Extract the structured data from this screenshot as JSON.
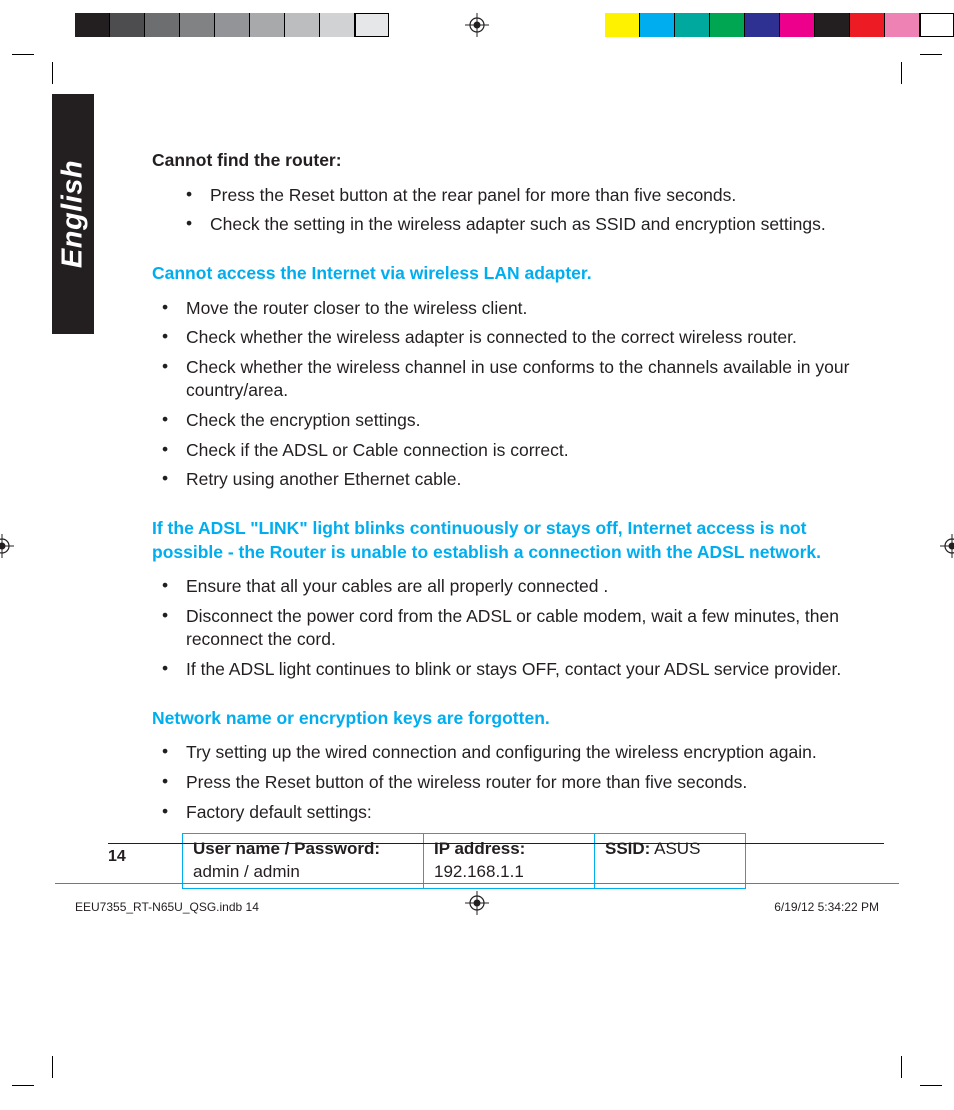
{
  "language_tab": "English",
  "section1": {
    "heading": "Cannot find the router:",
    "items": [
      "Press the Reset button at the rear panel for more than five seconds.",
      "Check the setting in the wireless adapter such as SSID and encryption settings."
    ]
  },
  "section2": {
    "heading": "Cannot access the Internet via wireless LAN adapter.",
    "items": [
      "Move the router closer to the wireless client.",
      "Check whether the wireless adapter is connected to the correct wireless router.",
      "Check whether the wireless channel in use conforms to the channels available in your country/area.",
      "Check the encryption settings.",
      "Check if the ADSL or Cable connection is correct.",
      "Retry using another Ethernet cable."
    ]
  },
  "section3": {
    "heading": "If the ADSL \"LINK\" light blinks continuously or stays off, Internet access is not possible - the Router is unable to establish a connection with the ADSL network.",
    "items": [
      "Ensure that all your cables are all properly connected .",
      "Disconnect the power cord from the ADSL or cable modem, wait a few minutes, then reconnect the cord.",
      "If the ADSL light continues to blink or stays OFF, contact your ADSL service provider."
    ]
  },
  "section4": {
    "heading": "Network name or encryption keys are forgotten.",
    "items": [
      "Try setting up the wired connection and configuring the wireless encryption again.",
      "Press the Reset button of the wireless router for more than five seconds.",
      "Factory default settings:"
    ]
  },
  "defaults_table": {
    "userpass_label": "User name / Password:",
    "userpass_value": "admin / admin",
    "ip_label": "IP address:",
    "ip_value": "192.168.1.1",
    "ssid_label": "SSID:",
    "ssid_value": " ASUS"
  },
  "page_number": "14",
  "footer": {
    "filename": "EEU7355_RT-N65U_QSG.indb   14",
    "timestamp": "6/19/12   5:34:22 PM"
  }
}
